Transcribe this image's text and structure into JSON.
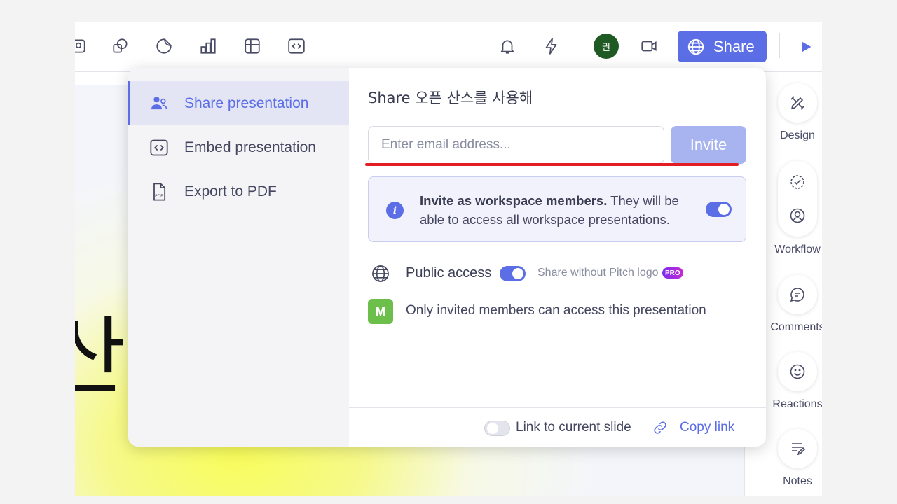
{
  "toolbar": {
    "icons": [
      "image-icon",
      "shapes-icon",
      "sticker-icon",
      "chart-icon",
      "table-icon",
      "embed-icon",
      "bell-icon",
      "lightning-icon",
      "camera-icon",
      "play-icon"
    ],
    "avatar_initial": "권",
    "share_label": "Share"
  },
  "slide": {
    "visible_text": "산"
  },
  "right_rail": {
    "design_label": "Design",
    "workflow_label": "Workflow",
    "comments_label": "Comments",
    "reactions_label": "Reactions",
    "notes_label": "Notes"
  },
  "dialog": {
    "sidebar": {
      "items": [
        {
          "label": "Share presentation",
          "active": true
        },
        {
          "label": "Embed presentation",
          "active": false
        },
        {
          "label": "Export to PDF",
          "active": false
        }
      ]
    },
    "title": "Share 오픈 산스를 사용해",
    "email_placeholder": "Enter email address...",
    "email_value": "",
    "invite_label": "Invite",
    "info": {
      "bold": "Invite as workspace members.",
      "text": " They will be able to access all workspace presentations.",
      "toggle_on": true
    },
    "public_access": {
      "label": "Public access",
      "toggle_on": true,
      "logo_label": "Share without Pitch logo",
      "badge": "PRO"
    },
    "members": {
      "initial": "M",
      "text": "Only invited members can access this presentation"
    },
    "footer": {
      "link_label": "Link to current slide",
      "link_toggle_on": false,
      "copy_label": "Copy link"
    }
  },
  "colors": {
    "accent": "#5b6ee6",
    "invite_disabled": "#a8b4f0",
    "highlight_line": "#e21d23",
    "avatar_bg": "#1f5a24",
    "member_badge": "#6bbf4a"
  }
}
